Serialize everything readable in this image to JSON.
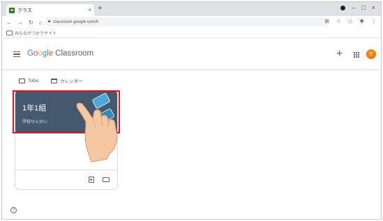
{
  "browser": {
    "tab_title": "クラス",
    "tab_close": "×",
    "new_tab": "+",
    "url": "classroom.google.com/h",
    "bookmark": "みんながつかうサイト",
    "window_controls": [
      "–",
      "□",
      "×"
    ]
  },
  "header": {
    "brand_google": [
      "G",
      "o",
      "o",
      "g",
      "l",
      "e"
    ],
    "brand_google_colors": [
      "#4285f4",
      "#ea4335",
      "#fbbc05",
      "#4285f4",
      "#34a853",
      "#ea4335"
    ],
    "brand_product": "Classroom",
    "avatar_initial": "せ",
    "avatar_color": "#f57c00"
  },
  "subnav": {
    "todo_label": "ToDo",
    "calendar_label": "カレンダー"
  },
  "class_card": {
    "title": "1年1組",
    "teacher": "学校せんせい",
    "banner_color": "#44596e"
  },
  "annotation": {
    "highlight_color": "#e0141e"
  }
}
